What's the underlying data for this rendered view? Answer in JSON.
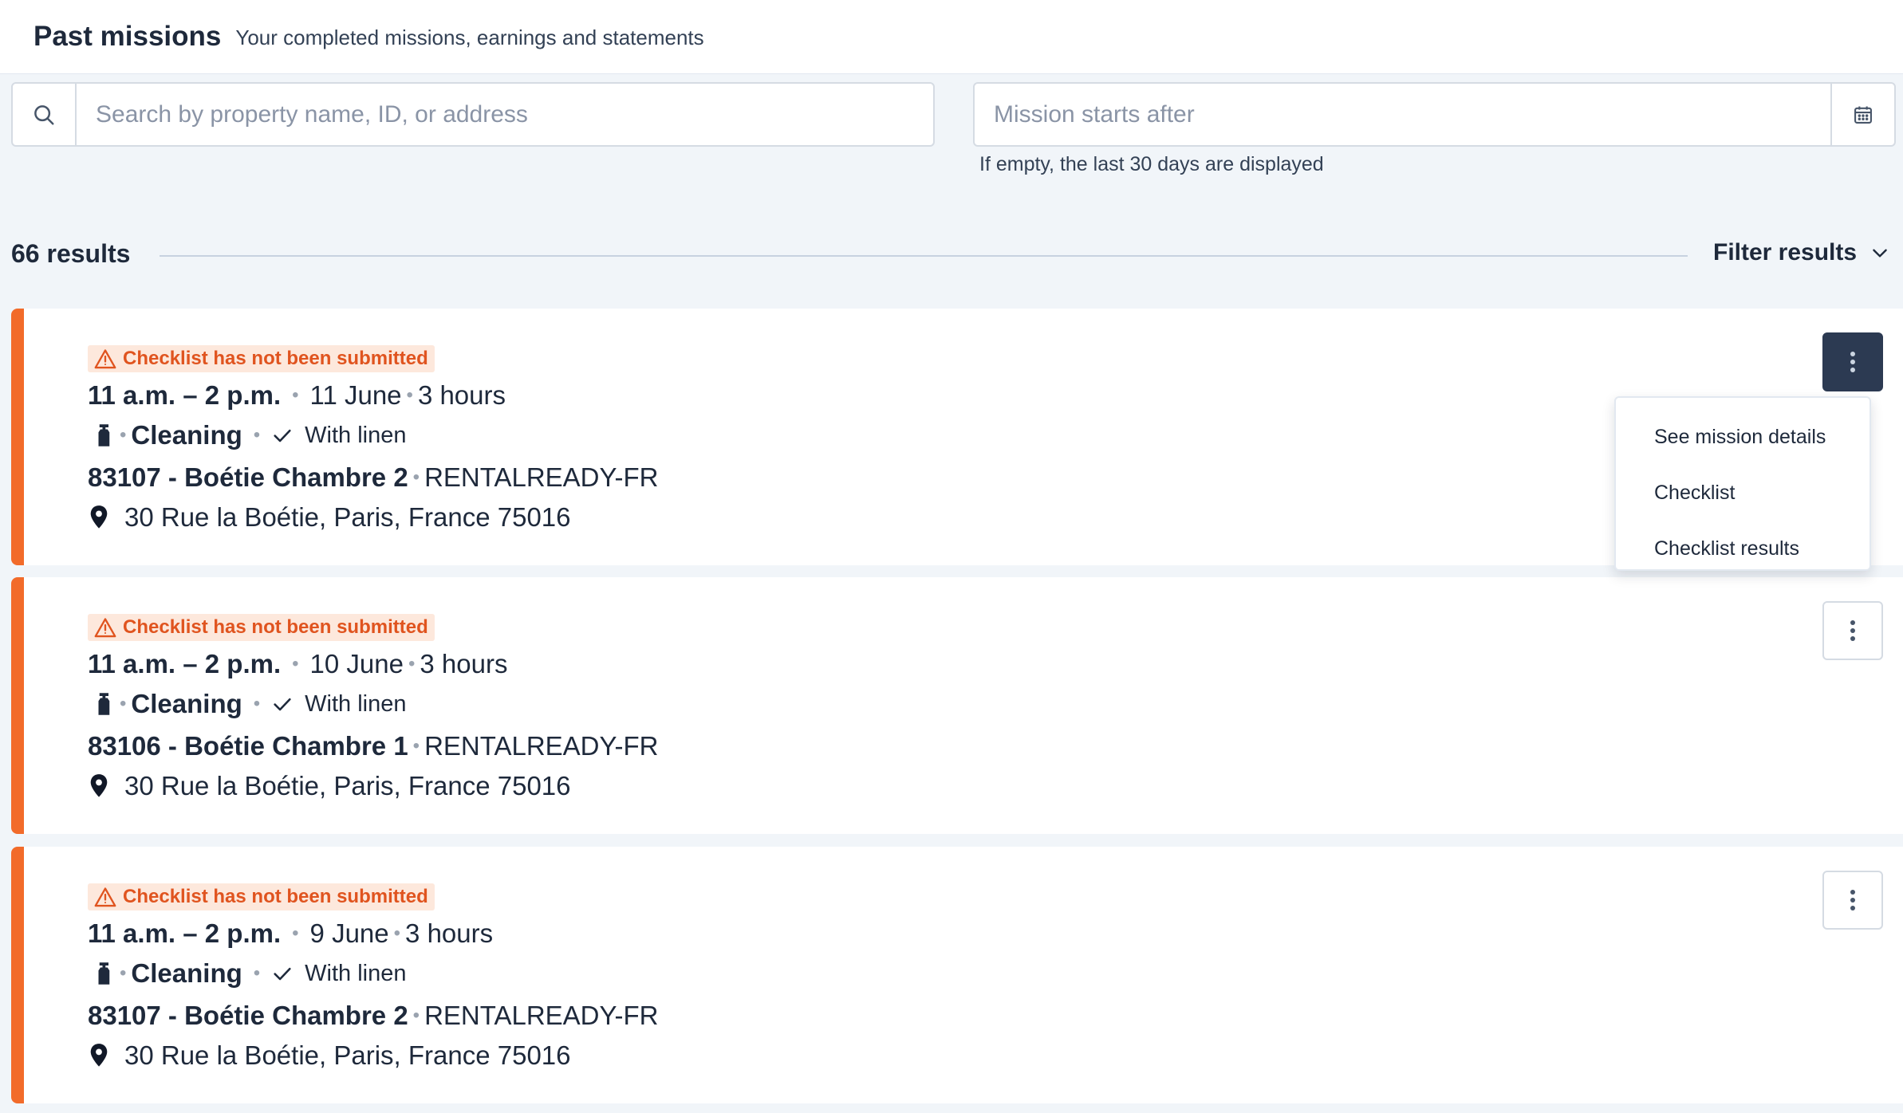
{
  "header": {
    "title": "Past missions",
    "subtitle": "Your completed missions, earnings and statements"
  },
  "search": {
    "placeholder": "Search by property name, ID, or address",
    "value": ""
  },
  "date_filter": {
    "placeholder": "Mission starts after",
    "value": "",
    "hint": "If empty, the last 30 days are displayed"
  },
  "results": {
    "count_label": "66 results",
    "filter_label": "Filter results"
  },
  "missions": [
    {
      "warning": "Checklist has not been submitted",
      "time": "11 a.m. – 2 p.m.",
      "date": "11 June",
      "duration": "3 hours",
      "type": "Cleaning",
      "linen": "With linen",
      "property": "83107 - Boétie Chambre 2",
      "company": "RENTALREADY-FR",
      "address": "30 Rue la Boétie, Paris, France 75016",
      "menu_open": true
    },
    {
      "warning": "Checklist has not been submitted",
      "time": "11 a.m. – 2 p.m.",
      "date": "10 June",
      "duration": "3 hours",
      "type": "Cleaning",
      "linen": "With linen",
      "property": "83106 - Boétie Chambre 1",
      "company": "RENTALREADY-FR",
      "address": "30 Rue la Boétie, Paris, France 75016",
      "menu_open": false
    },
    {
      "warning": "Checklist has not been submitted",
      "time": "11 a.m. – 2 p.m.",
      "date": "9 June",
      "duration": "3 hours",
      "type": "Cleaning",
      "linen": "With linen",
      "property": "83107 - Boétie Chambre 2",
      "company": "RENTALREADY-FR",
      "address": "30 Rue la Boétie, Paris, France 75016",
      "menu_open": false
    }
  ],
  "dropdown": {
    "items": [
      "See mission details",
      "Checklist",
      "Checklist results"
    ]
  },
  "colors": {
    "accent_orange": "#f26b2a",
    "warning_bg": "#fde8dc",
    "warning_text": "#e0541f",
    "kebab_active": "#2c3a52"
  }
}
